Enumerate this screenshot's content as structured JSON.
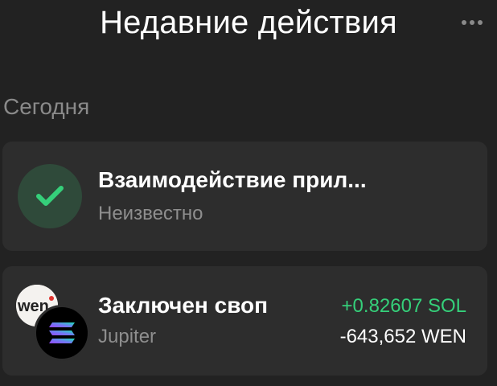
{
  "header": {
    "title": "Недавние действия",
    "more_icon": "more-horizontal-icon"
  },
  "section": {
    "label": "Сегодня"
  },
  "activities": [
    {
      "icon": "check-icon",
      "title": "Взаимодействие прил...",
      "subtitle": "Неизвестно"
    },
    {
      "icon": "token-pair-icon",
      "title": "Заключен своп",
      "subtitle": "Jupiter",
      "amount_in": "+0.82607 SOL",
      "amount_out": "-643,652 WEN",
      "token_a_logo_text": "wen",
      "token_b": "solana-logo"
    }
  ],
  "colors": {
    "background": "#222222",
    "card": "#2d2d2d",
    "positive": "#35d07a",
    "check_bg": "#2f4a3a",
    "muted_text": "#8e8e8e"
  }
}
